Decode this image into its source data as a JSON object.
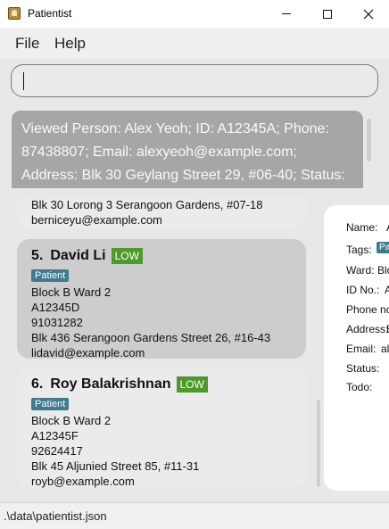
{
  "window": {
    "title": "Patientist",
    "icon": "app-icon",
    "minimize_icon": "minimize-icon",
    "maximize_icon": "maximize-icon",
    "close_icon": "close-icon"
  },
  "menu": {
    "file": "File",
    "help": "Help"
  },
  "command": {
    "value": "",
    "placeholder": ""
  },
  "result": {
    "text": "Viewed Person: Alex Yeoh; ID: A12345A; Phone: 87438807; Email: alexyeoh@example.com; Address: Blk 30 Geylang Street 29, #06-40; Status:"
  },
  "partial_card": {
    "address": "Blk 30 Lorong 3 Serangoon Gardens, #07-18",
    "email": "berniceyu@example.com"
  },
  "persons": [
    {
      "index": "5.",
      "name": "David Li",
      "priority": "LOW",
      "tag": "Patient",
      "ward": "Block B Ward 2",
      "id": "A12345D",
      "phone": "91031282",
      "address": "Blk 436 Serangoon Gardens Street 26, #16-43",
      "email": "lidavid@example.com",
      "selected": true
    },
    {
      "index": "6.",
      "name": "Roy Balakrishnan",
      "priority": "LOW",
      "tag": "Patient",
      "ward": "Block B Ward 2",
      "id": "A12345F",
      "phone": "92624417",
      "address": "Blk 45 Aljunied Street 85, #11-31",
      "email": "royb@example.com",
      "selected": false
    }
  ],
  "detail": {
    "name_label": "Name:",
    "name_value": "A",
    "tags_label": "Tags:",
    "tag_value": "Pa",
    "ward_label": "Ward:",
    "ward_value": "Blo",
    "id_label": "ID No.:",
    "id_value": "A",
    "phone_label": "Phone no",
    "address_label": "Address:",
    "address_value": "B",
    "email_label": "Email:",
    "email_value": "al",
    "status_label": "Status:",
    "todo_label": "Todo:"
  },
  "status": {
    "path": ".\\data\\patientist.json"
  },
  "colors": {
    "priority_low": "#4c9a2a",
    "tag": "#3e7b91",
    "result_bg": "#a6a6a6"
  }
}
